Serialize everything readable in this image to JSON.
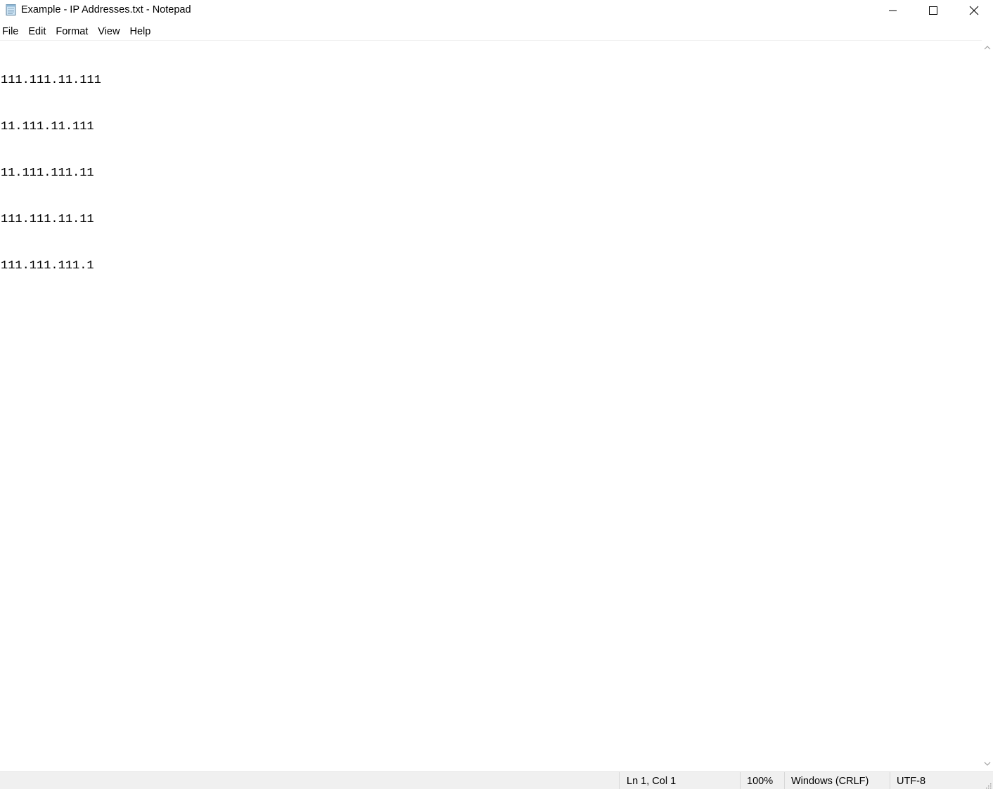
{
  "window": {
    "title": "Example - IP Addresses.txt - Notepad"
  },
  "titlebar_controls": {
    "minimize_icon": "minimize-icon",
    "maximize_icon": "maximize-icon",
    "close_icon": "close-icon"
  },
  "menu": {
    "items": [
      {
        "label": "File"
      },
      {
        "label": "Edit"
      },
      {
        "label": "Format"
      },
      {
        "label": "View"
      },
      {
        "label": "Help"
      }
    ]
  },
  "editor": {
    "lines": [
      "111.111.11.111",
      "11.111.11.111",
      "11.111.111.11",
      "111.111.11.11",
      "111.111.111.1"
    ]
  },
  "statusbar": {
    "position": "Ln 1, Col 1",
    "zoom": "100%",
    "line_ending": "Windows (CRLF)",
    "encoding": "UTF-8"
  },
  "colors": {
    "background": "#ffffff",
    "statusbar_bg": "#f0f0f0",
    "text": "#000000"
  }
}
